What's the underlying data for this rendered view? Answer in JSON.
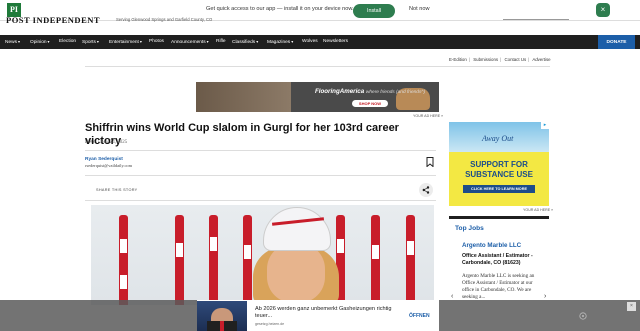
{
  "app_banner": {
    "message": "Get quick access to our app — install it on your device now.",
    "install_label": "Install",
    "not_now_label": "Not now",
    "close_label": "×"
  },
  "masthead": {
    "logo_mark": "PI",
    "logo_text": "POST INDEPENDENT",
    "tagline": "Serving Glenwood Springs and Garfield County, CO"
  },
  "nav": {
    "items": [
      {
        "label": "News",
        "dropdown": true
      },
      {
        "label": "Opinion",
        "dropdown": true
      },
      {
        "label": "Election",
        "dropdown": false
      },
      {
        "label": "Sports",
        "dropdown": true
      },
      {
        "label": "Entertainment",
        "dropdown": true
      },
      {
        "label": "Photos",
        "dropdown": false
      },
      {
        "label": "Announcements",
        "dropdown": true
      },
      {
        "label": "Rifle",
        "dropdown": false
      },
      {
        "label": "Classifieds",
        "dropdown": true
      },
      {
        "label": "Magazines",
        "dropdown": true
      },
      {
        "label": "Wolves",
        "dropdown": false
      },
      {
        "label": "Newsletters",
        "dropdown": false
      }
    ],
    "donate_label": "DONATE"
  },
  "utility_links": [
    "E-Edition",
    "Submissions",
    "Contact Us",
    "Advertise"
  ],
  "top_ad": {
    "brand": "FlooringAmerica",
    "tagline": "where friends (and friends^)",
    "cta": "SHOP NOW",
    "label": "YOUR AD HERE »"
  },
  "article": {
    "headline": "Shiffrin wins World Cup slalom in Gurgl for her 103rd career victory",
    "section": "News",
    "date": "Nov 24, 2025",
    "author": "Ryan Sederquist",
    "email": "rsederquist@vaildaily.com",
    "share_label": "SHARE THIS STORY"
  },
  "sidebar_ad": {
    "title": "Away Out",
    "headline": "SUPPORT FOR SUBSTANCE USE",
    "cta": "CLICK HERE TO LEARN MORE",
    "label": "YOUR AD HERE »"
  },
  "top_jobs": {
    "heading": "Top Jobs",
    "company": "Argento Marble LLC",
    "position": "Office Assistant / Estimator - Carbondale, CO (81623)",
    "description": "Argento Marble LLC is seeking an Office Assistant / Estimator at our office in Carbondale, CO. We are seeking a...",
    "prev": "‹",
    "next": "›"
  },
  "bottom_ad": {
    "title": "Ab 2026 werden ganz unbemerkt Gasheizungen richtig teuer...",
    "source": "gesetzg.heizen.de",
    "open_label": "ÖFFNEN",
    "close_label": "×"
  },
  "colors": {
    "brand_green": "#1f7a3a",
    "nav_bg": "#1f1f1f",
    "accent_blue": "#1c5ea8",
    "install_green": "#2e7d4f"
  }
}
